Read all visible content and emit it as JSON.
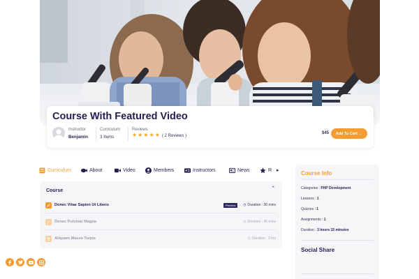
{
  "course": {
    "title": "Course With Featured Video",
    "instructor_label": "Instructor",
    "instructor_name": "Benjamin",
    "curriculum_label": "Curriculum",
    "curriculum_value": "3 Items",
    "reviews_label": "Reviews",
    "rating": 5,
    "reviews_value": "( 2 Reviews )",
    "price": "$45",
    "add_to_cart": "Add To Cart"
  },
  "tabs": [
    {
      "label": "Curriculum",
      "icon": "book-icon",
      "active": true
    },
    {
      "label": "About",
      "icon": "fish-icon",
      "active": false
    },
    {
      "label": "Video",
      "icon": "video-icon",
      "active": false
    },
    {
      "label": "Members",
      "icon": "user-circle-icon",
      "active": false
    },
    {
      "label": "Instructors",
      "icon": "id-card-icon",
      "active": false
    },
    {
      "label": "News",
      "icon": "newspaper-icon",
      "active": false
    },
    {
      "label": "R",
      "icon": "star-icon",
      "active": false
    }
  ],
  "curriculum": {
    "section_title": "Course",
    "lessons": [
      {
        "title": "Donec Vitae Sapien Ut Libero",
        "badge": "Preview",
        "duration": "Duration : 30 mins",
        "locked": false
      },
      {
        "title": "Donec Pulvinar Magna",
        "badge": "",
        "duration": "Duration : 45 mins",
        "locked": true
      },
      {
        "title": "Aliquam Massa Turpis",
        "badge": "",
        "duration": "Duration : 3 hrs",
        "locked": true
      }
    ]
  },
  "course_info": {
    "heading": "Course Info",
    "rows": [
      {
        "label": "Categories :",
        "value": "PHP Development"
      },
      {
        "label": "Lessons :",
        "value": "1"
      },
      {
        "label": "Quizzes :",
        "value": "1"
      },
      {
        "label": "Assignments :",
        "value": "1"
      },
      {
        "label": "Duration :",
        "value": "3 hours 15 minutes"
      }
    ]
  },
  "social_share": {
    "heading": "Social Share",
    "icons": [
      "facebook-icon",
      "twitter-icon",
      "youtube-icon",
      "instagram-icon"
    ]
  },
  "colors": {
    "accent": "#f39c32",
    "navy": "#221f4f",
    "panel": "#f6f6f9"
  }
}
